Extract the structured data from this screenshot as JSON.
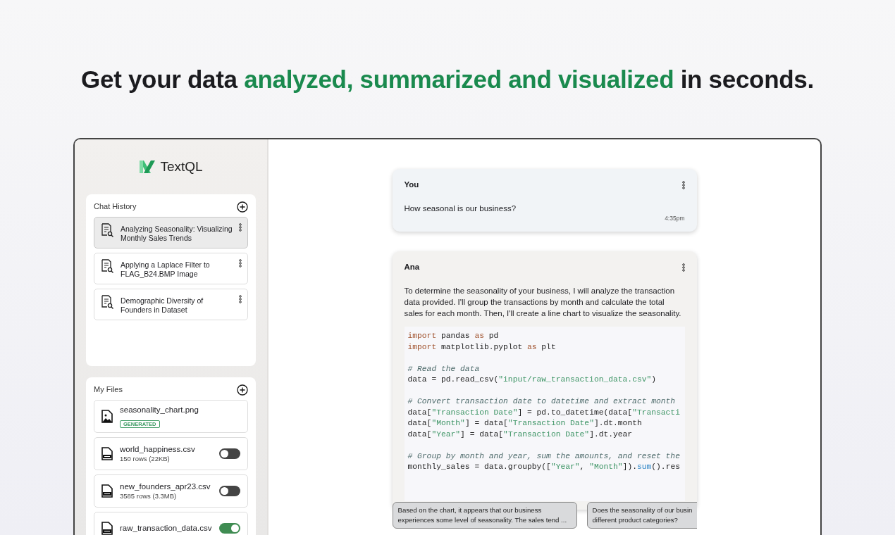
{
  "headline": "Get your data **analyzed, summarized and visualized** in seconds.",
  "app": {
    "logo": "TextQL"
  },
  "chat_history": {
    "title": "Chat History",
    "items": [
      {
        "title": "Analyzing Seasonality: Visualizing Monthly Sales Trends",
        "selected": true
      },
      {
        "title": "Applying a Laplace Filter to FLAG_B24.BMP Image",
        "selected": false
      },
      {
        "title": "Demographic Diversity of Founders in Dataset",
        "selected": false
      }
    ]
  },
  "files": {
    "title": "My Files",
    "items": [
      {
        "kind": "image",
        "name": "seasonality_chart.png",
        "badge": "GENERATED"
      },
      {
        "kind": "csv",
        "name": "world_happiness.csv",
        "meta": "150 rows (22KB)",
        "on": false
      },
      {
        "kind": "csv",
        "name": "new_founders_apr23.csv",
        "meta": "3585 rows (3.3MB)",
        "on": false
      },
      {
        "kind": "csv",
        "name": "raw_transaction_data.csv",
        "on": true
      }
    ]
  },
  "messages": [
    {
      "kind": "user",
      "author": "You",
      "text": "How seasonal is our business?",
      "time": "4:35pm"
    },
    {
      "kind": "assistant",
      "author": "Ana",
      "text": "To determine the seasonality of your business, I will analyze the transaction data provided. I'll group the transactions by month and calculate the total sales for each month. Then, I'll create a line chart to visualize the seasonality.",
      "code": [
        {
          "kind": "code",
          "tokens": [
            {
              "kind": "keyword",
              "text": "import"
            },
            {
              "kind": "plain",
              "text": " pandas "
            },
            {
              "kind": "keyword",
              "text": "as"
            },
            {
              "kind": "plain",
              "text": " pd"
            }
          ]
        },
        {
          "kind": "code",
          "tokens": [
            {
              "kind": "keyword",
              "text": "import"
            },
            {
              "kind": "plain",
              "text": " matplotlib.pyplot "
            },
            {
              "kind": "keyword",
              "text": "as"
            },
            {
              "kind": "plain",
              "text": " plt"
            }
          ]
        },
        {
          "kind": "blank"
        },
        {
          "kind": "code",
          "tokens": [
            {
              "kind": "comment",
              "text": "# Read the data"
            }
          ]
        },
        {
          "kind": "code",
          "tokens": [
            {
              "kind": "plain",
              "text": "data = pd.read_csv("
            },
            {
              "kind": "string",
              "text": "\"input/raw_transaction_data.csv\""
            },
            {
              "kind": "plain",
              "text": ")"
            }
          ]
        },
        {
          "kind": "blank"
        },
        {
          "kind": "code",
          "tokens": [
            {
              "kind": "comment",
              "text": "# Convert transaction date to datetime and extract month"
            }
          ]
        },
        {
          "kind": "code",
          "tokens": [
            {
              "kind": "plain",
              "text": "data["
            },
            {
              "kind": "string",
              "text": "\"Transaction Date\""
            },
            {
              "kind": "plain",
              "text": "] = pd.to_datetime(data["
            },
            {
              "kind": "string",
              "text": "\"Transacti"
            }
          ]
        },
        {
          "kind": "code",
          "tokens": [
            {
              "kind": "plain",
              "text": "data["
            },
            {
              "kind": "string",
              "text": "\"Month\""
            },
            {
              "kind": "plain",
              "text": "] = data["
            },
            {
              "kind": "string",
              "text": "\"Transaction Date\""
            },
            {
              "kind": "plain",
              "text": "].dt.month"
            }
          ]
        },
        {
          "kind": "code",
          "tokens": [
            {
              "kind": "plain",
              "text": "data["
            },
            {
              "kind": "string",
              "text": "\"Year\""
            },
            {
              "kind": "plain",
              "text": "] = data["
            },
            {
              "kind": "string",
              "text": "\"Transaction Date\""
            },
            {
              "kind": "plain",
              "text": "].dt.year"
            }
          ]
        },
        {
          "kind": "blank"
        },
        {
          "kind": "code",
          "tokens": [
            {
              "kind": "comment",
              "text": "# Group by month and year, sum the amounts, and reset the"
            }
          ]
        },
        {
          "kind": "code",
          "tokens": [
            {
              "kind": "plain",
              "text": "monthly_sales = data.groupby(["
            },
            {
              "kind": "string",
              "text": "\"Year\""
            },
            {
              "kind": "plain",
              "text": ", "
            },
            {
              "kind": "string",
              "text": "\"Month\""
            },
            {
              "kind": "plain",
              "text": "])."
            },
            {
              "kind": "func",
              "text": "sum"
            },
            {
              "kind": "plain",
              "text": "().res"
            }
          ]
        }
      ]
    }
  ],
  "suggestions": [
    "Based on the chart, it appears that our business experiences some level of seasonality. The sales tend ...",
    "Does the seasonality of our busin different product categories?"
  ]
}
